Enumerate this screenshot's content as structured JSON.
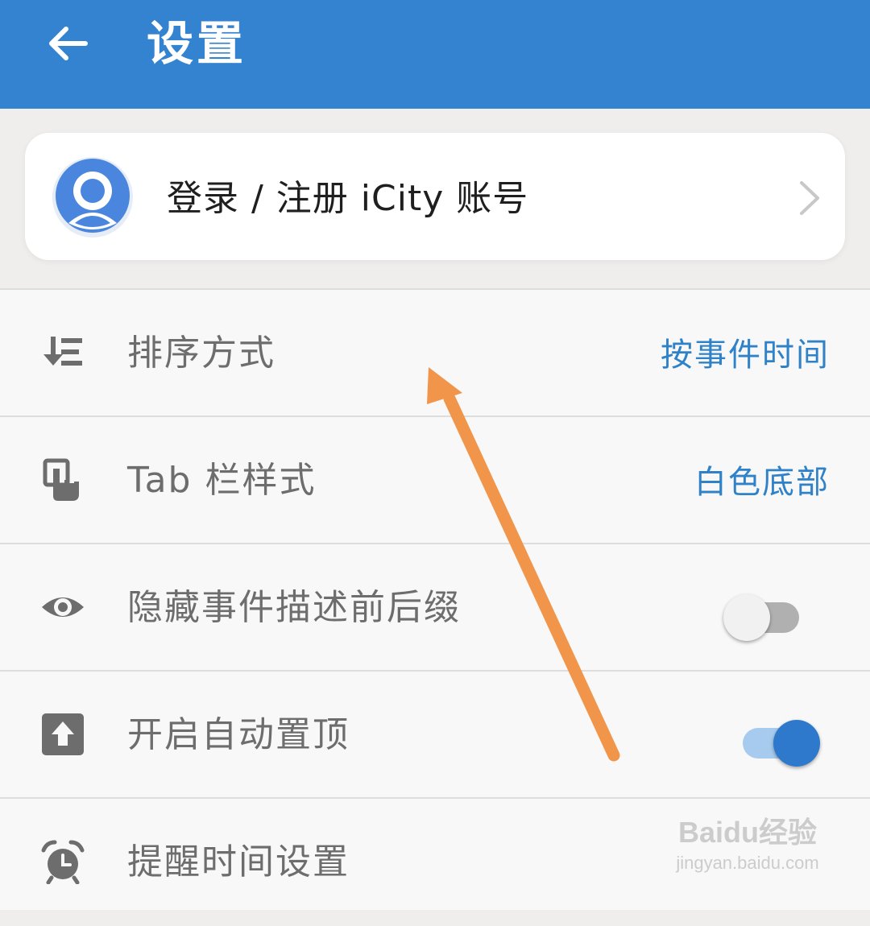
{
  "header": {
    "title": "设置",
    "back_icon": "arrow-left-icon",
    "background": "#3483d0"
  },
  "account": {
    "label": "登录 / 注册 iCity 账号",
    "avatar_icon": "user-avatar-icon",
    "chevron_icon": "chevron-right-icon"
  },
  "settings": {
    "sort": {
      "label": "排序方式",
      "value": "按事件时间",
      "icon": "sort-list-icon"
    },
    "tab_style": {
      "label": "Tab 栏样式",
      "value": "白色底部",
      "icon": "touch-hand-icon"
    },
    "hide_prefix": {
      "label": "隐藏事件描述前后缀",
      "enabled": false,
      "icon": "eye-icon"
    },
    "auto_top": {
      "label": "开启自动置顶",
      "enabled": true,
      "icon": "upload-box-icon"
    },
    "reminder": {
      "label": "提醒时间设置",
      "icon": "alarm-clock-icon"
    }
  },
  "watermark": {
    "main": "Baidu经验",
    "sub": "jingyan.baidu.com"
  },
  "colors": {
    "accent": "#3483d0",
    "value_text": "#2f82c8",
    "annotation_arrow": "#f0954a"
  }
}
